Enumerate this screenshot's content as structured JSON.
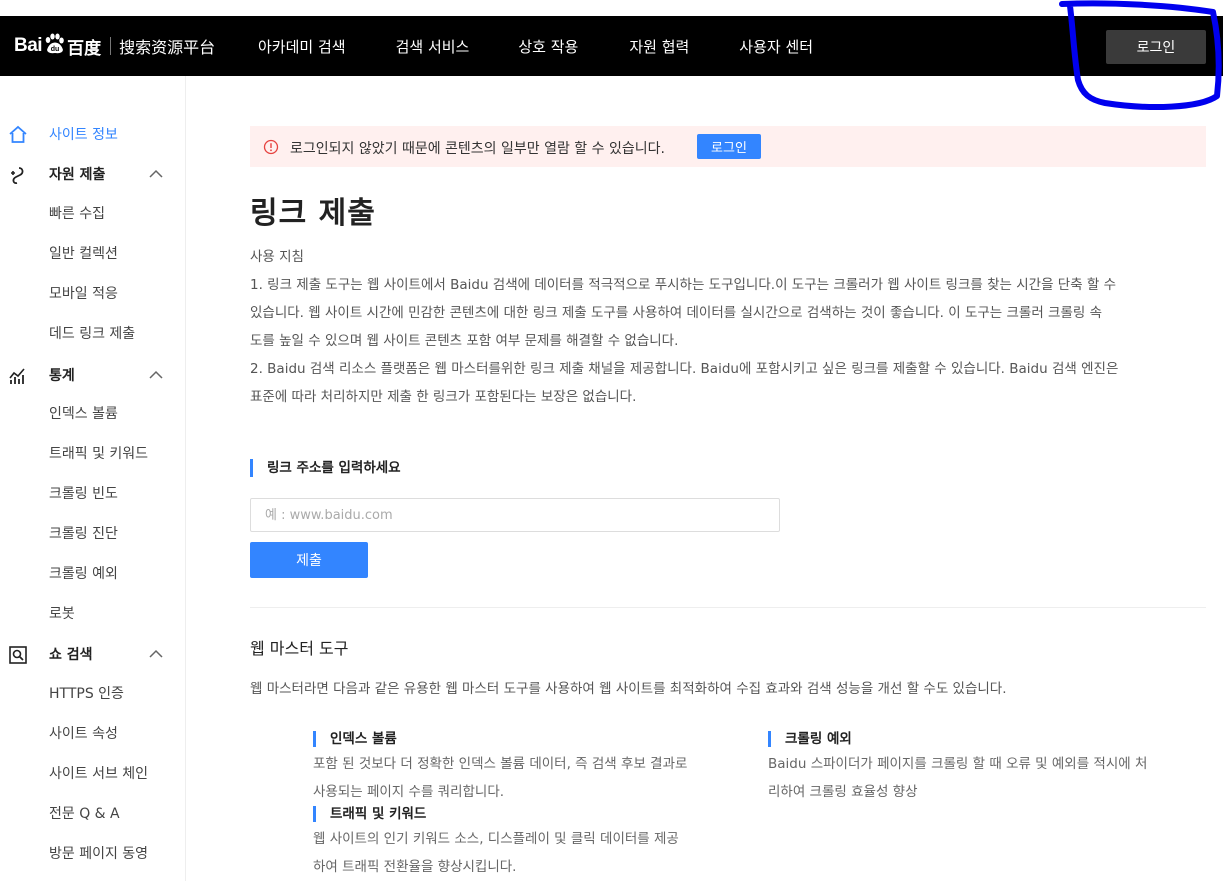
{
  "header": {
    "logo_text": "Bai",
    "logo_cn": "百度",
    "logo_platform": "搜索资源平台",
    "nav": [
      "아카데미 검색",
      "검색 서비스",
      "상호 작용",
      "자원 협력",
      "사용자 센터"
    ],
    "login_label": "로그인"
  },
  "sidebar": {
    "sections": [
      {
        "label": "사이트 정보",
        "icon": "home-icon",
        "active": true
      },
      {
        "label": "자원 제출",
        "icon": "submit-icon",
        "items": [
          "빠른 수집",
          "일반 컬렉션",
          "모바일 적응",
          "데드 링크 제출"
        ]
      },
      {
        "label": "통계",
        "icon": "chart-icon",
        "items": [
          "인덱스 볼륨",
          "트래픽 및 키워드",
          "크롤링 빈도",
          "크롤링 진단",
          "크롤링 예외",
          "로봇"
        ]
      },
      {
        "label": "쇼 검색",
        "icon": "search-icon",
        "items": [
          "HTTPS 인증",
          "사이트 속성",
          "사이트 서브 체인",
          "전문 Q & A",
          "방문 페이지 동영"
        ]
      }
    ]
  },
  "notice": {
    "text": "로그인되지 않았기 때문에 콘텐츠의 일부만 열람 할 수 있습니다.",
    "button": "로그인"
  },
  "main": {
    "title": "링크 제출",
    "guide": [
      "사용 지침",
      "1. 링크 제출 도구는 웹 사이트에서 Baidu 검색에 데이터를 적극적으로 푸시하는 도구입니다.이 도구는 크롤러가 웹 사이트 링크를 찾는 시간을 단축 할 수",
      "있습니다. 웹 사이트 시간에 민감한 콘텐츠에 대한 링크 제출 도구를 사용하여 데이터를 실시간으로 검색하는 것이 좋습니다. 이 도구는 크롤러 크롤링 속",
      "도를 높일 수 있으며 웹 사이트 콘텐츠 포함 여부 문제를 해결할 수 없습니다.",
      "2. Baidu 검색 리소스 플랫폼은 웹 마스터를위한 링크 제출 채널을 제공합니다. Baidu에 포함시키고 싶은 링크를 제출할 수 있습니다. Baidu 검색 엔진은",
      "표준에 따라 처리하지만 제출 한 링크가 포함된다는 보장은 없습니다."
    ],
    "input_label": "링크 주소를 입력하세요",
    "input_placeholder": "예 : www.baidu.com",
    "input_value": "",
    "submit_label": "제출",
    "tools_title": "웹 마스터 도구",
    "tools_desc": "웹 마스터라면 다음과 같은 유용한 웹 마스터 도구를 사용하여 웹 사이트를 최적화하여 수집 효과와 검색 성능을 개선 할 수도 있습니다.",
    "tools": [
      {
        "name": "인덱스 볼륨",
        "desc": "포함 된 것보다 더 정확한 인덱스 볼륨 데이터, 즉 검색 후보 결과로 사용되는 페이지 수를 쿼리합니다."
      },
      {
        "name": "크롤링 예외",
        "desc": "Baidu 스파이더가 페이지를 크롤링 할 때 오류 및 예외를 적시에 처리하여 크롤링 효율성 향상"
      },
      {
        "name": "트래픽 및 키워드",
        "desc": "웹 사이트의 인기 키워드 소스, 디스플레이 및 클릭 데이터를 제공하여 트래픽 전환율을 향상시킵니다."
      }
    ]
  },
  "colors": {
    "accent": "#3385ff",
    "annotation": "#0000ee",
    "header_bg": "#000000",
    "notice_bg": "#fff0ef"
  }
}
